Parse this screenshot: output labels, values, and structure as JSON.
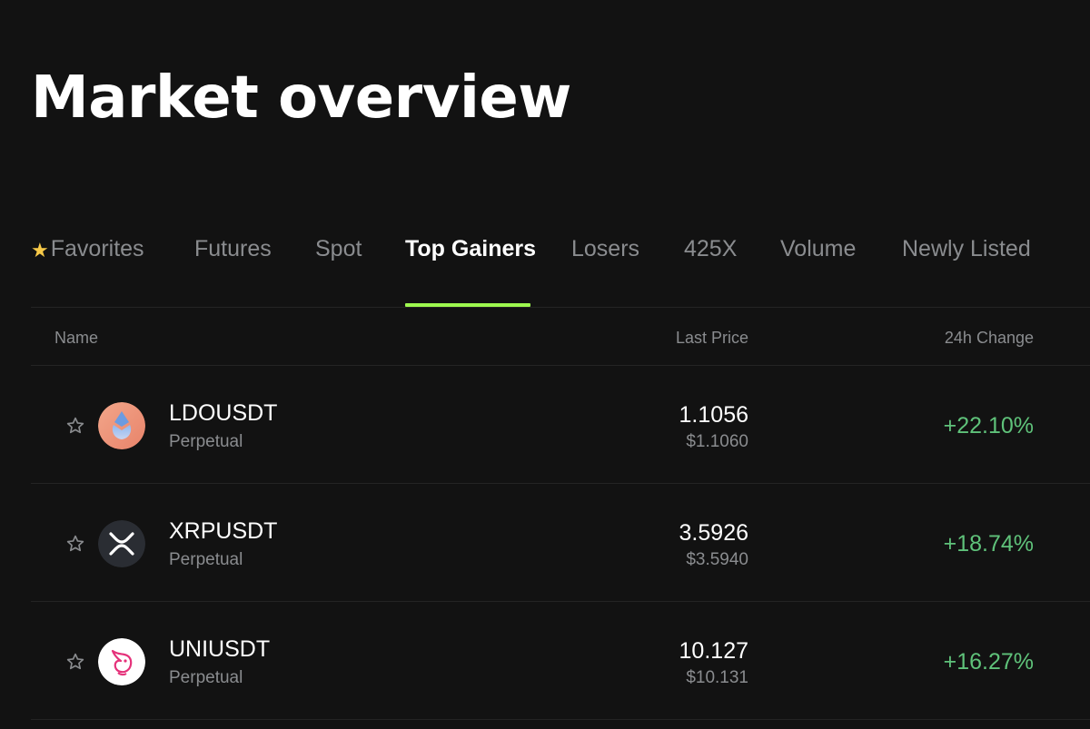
{
  "page": {
    "title": "Market overview"
  },
  "tabs": [
    {
      "label": "Favorites",
      "icon": "star-icon"
    },
    {
      "label": "Futures"
    },
    {
      "label": "Spot"
    },
    {
      "label": "Top Gainers",
      "active": true
    },
    {
      "label": "Losers"
    },
    {
      "label": "425X"
    },
    {
      "label": "Volume"
    },
    {
      "label": "Newly Listed"
    }
  ],
  "table": {
    "headers": {
      "name": "Name",
      "last_price": "Last Price",
      "change": "24h Change"
    },
    "rows": [
      {
        "symbol": "LDOUSDT",
        "contract": "Perpetual",
        "price": "1.1056",
        "price_usd": "$1.1060",
        "change": "+22.10%",
        "icon": "lido-logo-icon"
      },
      {
        "symbol": "XRPUSDT",
        "contract": "Perpetual",
        "price": "3.5926",
        "price_usd": "$3.5940",
        "change": "+18.74%",
        "icon": "xrp-logo-icon"
      },
      {
        "symbol": "UNIUSDT",
        "contract": "Perpetual",
        "price": "10.127",
        "price_usd": "$10.131",
        "change": "+16.27%",
        "icon": "uniswap-logo-icon"
      }
    ]
  },
  "colors": {
    "background": "#121212",
    "accent": "#9ef84f",
    "positive": "#5fc27a",
    "muted": "#8a8c8f",
    "favorite_star": "#f7c948"
  }
}
